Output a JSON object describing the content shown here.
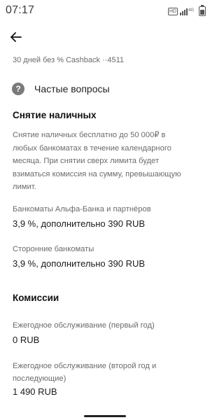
{
  "status_bar": {
    "time": "07:17",
    "hd_label": "HD",
    "network_label": "4G",
    "icons": [
      "hd-icon",
      "signal-icon",
      "battery-icon"
    ]
  },
  "header": {
    "back_icon": "arrow-left-icon",
    "subtitle": "30 дней без % Cashback ··4511"
  },
  "faq": {
    "icon_symbol": "?",
    "label": "Частые вопросы"
  },
  "cash_withdrawal": {
    "title": "Снятие наличных",
    "description": "Снятие наличных бесплатно до 50 000₽ в любых банкоматах в течение календарного месяца. При снятии сверх лимита будет взиматься комиссия на сумму, превышающую лимит.",
    "items": [
      {
        "label": "Банкоматы Альфа-Банка и партнёров",
        "value": "3,9 %, дополнительно 390 RUB"
      },
      {
        "label": "Сторонние банкоматы",
        "value": "3,9 %, дополнительно 390 RUB"
      }
    ]
  },
  "fees": {
    "title": "Комиссии",
    "items": [
      {
        "label": "Ежегодное обслуживание (первый год)",
        "value": "0 RUB"
      },
      {
        "label": "Ежегодное обслуживание (второй год и последующие)",
        "value": "1 490 RUB"
      }
    ]
  }
}
